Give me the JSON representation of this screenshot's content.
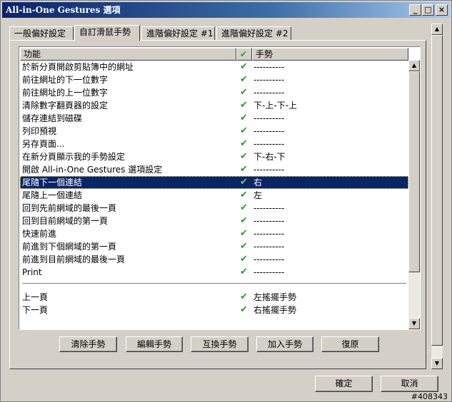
{
  "window": {
    "title": "All-in-One Gestures 選項"
  },
  "tabs": [
    {
      "label": "一般偏好設定"
    },
    {
      "label": "自訂滑鼠手勢"
    },
    {
      "label": "進階偏好設定 #1"
    },
    {
      "label": "進階偏好設定 #2"
    }
  ],
  "list": {
    "columns": {
      "function": "功能",
      "check_icon": "check-icon",
      "gesture": "手勢"
    },
    "rows": [
      {
        "function": "於新分頁開啟剪貼簿中的網址",
        "gesture": "----------"
      },
      {
        "function": "前往網址的下一位數字",
        "gesture": "----------"
      },
      {
        "function": "前往網址的上一位數字",
        "gesture": "----------"
      },
      {
        "function": "清除數字翻頁器的設定",
        "gesture": "下-上-下-上"
      },
      {
        "function": "儲存連結到磁碟",
        "gesture": "----------"
      },
      {
        "function": "列印預視",
        "gesture": "----------"
      },
      {
        "function": "另存頁面...",
        "gesture": "----------"
      },
      {
        "function": "在新分頁顯示我的手勢設定",
        "gesture": "下-右-下"
      },
      {
        "function": "開啟 All-in-One Gestures 選項設定",
        "gesture": "----------"
      },
      {
        "function": "尾隨下一個連結",
        "gesture": "右",
        "selected": true
      },
      {
        "function": "尾隨上一個連結",
        "gesture": "左"
      },
      {
        "function": "回到先前網域的最後一頁",
        "gesture": "----------"
      },
      {
        "function": "回到目前網域的第一頁",
        "gesture": "----------"
      },
      {
        "function": "快速前進",
        "gesture": "----------"
      },
      {
        "function": "前進到下個網域的第一頁",
        "gesture": "----------"
      },
      {
        "function": "前進到目前網域的最後一頁",
        "gesture": "----------"
      },
      {
        "function": "Print",
        "gesture": "----------"
      }
    ],
    "rocker_rows": [
      {
        "function": "上一頁",
        "gesture": "左搖擺手勢"
      },
      {
        "function": "下一頁",
        "gesture": "右搖擺手勢"
      }
    ]
  },
  "actions": {
    "clear": "清除手勢",
    "edit": "編輯手勢",
    "swap": "互換手勢",
    "add": "加入手勢",
    "restore": "復原"
  },
  "footer": {
    "ok": "確定",
    "cancel": "取消"
  },
  "status": {
    "id": "#408343"
  },
  "colors": {
    "titlebar": "#0a246a",
    "selection": "#0a246a",
    "check": "#2e9b2e",
    "face": "#d4d0c8"
  }
}
